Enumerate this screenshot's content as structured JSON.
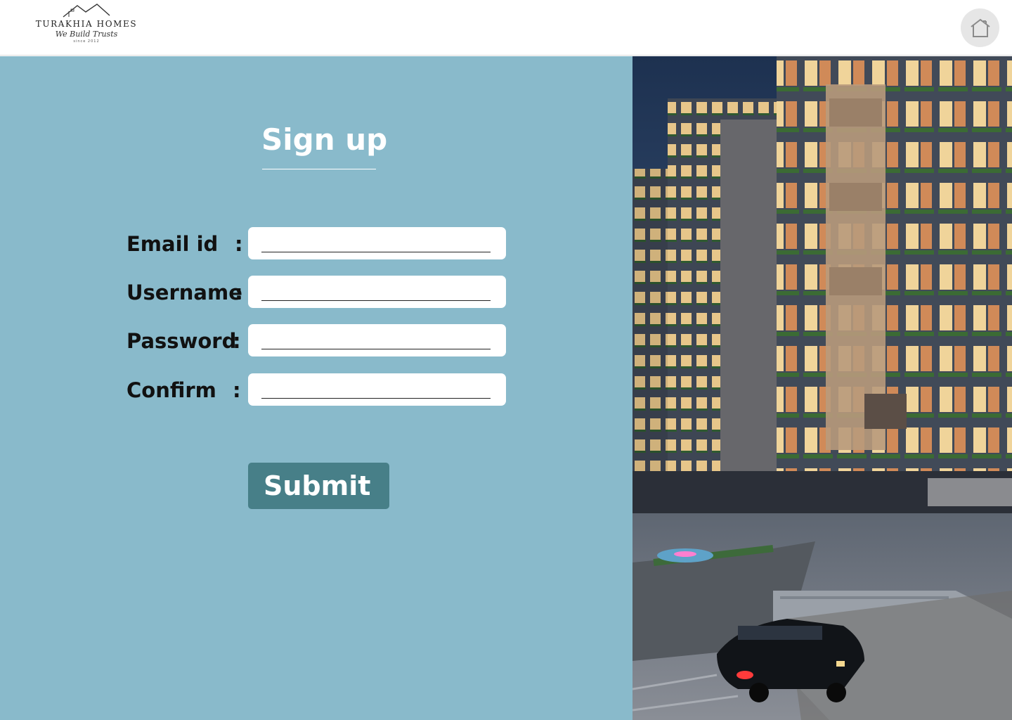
{
  "brand": {
    "name": "TURAKHIA HOMES",
    "tagline": "We Build Trusts",
    "since": "since 2012"
  },
  "header": {
    "home_icon": "home-icon"
  },
  "form": {
    "title": "Sign up",
    "fields": [
      {
        "label": "Email id",
        "colon": ":",
        "value": "",
        "placeholder": ""
      },
      {
        "label": "Username",
        "colon": ":",
        "value": "",
        "placeholder": ""
      },
      {
        "label": "Password",
        "colon": ":",
        "value": "",
        "placeholder": ""
      },
      {
        "label": "Confirm",
        "colon": ":",
        "value": "",
        "placeholder": ""
      }
    ],
    "submit_label": "Submit"
  },
  "colors": {
    "panel_bg": "#89bacb",
    "button_bg": "#477f88",
    "field_bg": "#ffffff",
    "text": "#111111"
  },
  "image": {
    "subject": "building-illustration"
  }
}
